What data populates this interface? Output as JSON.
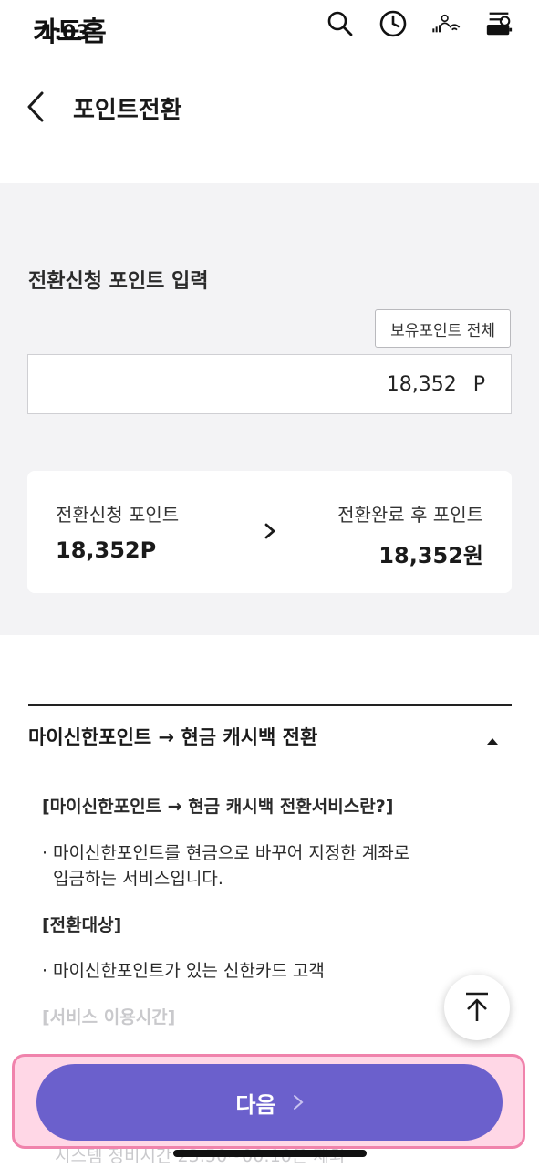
{
  "status_bar": {
    "carrier_title": "카드홈",
    "time": "1:03"
  },
  "header": {
    "title": "포인트전환"
  },
  "form": {
    "section_label": "전환신청 포인트 입력",
    "all_points_button": "보유포인트 전체",
    "amount": "18,352",
    "amount_unit": "P"
  },
  "summary": {
    "left_label": "전환신청 포인트",
    "left_value": "18,352P",
    "right_label": "전환완료 후 포인트",
    "right_value": "18,352원"
  },
  "accordion": {
    "title": "마이신한포인트 → 현금 캐시백 전환"
  },
  "info": {
    "heading1": "[마이신한포인트 → 현금 캐시백 전환서비스란?]",
    "bullet1_line1": "마이신한포인트를 현금으로 바꾸어 지정한 계좌로",
    "bullet1_line2": "입금하는 서비스입니다.",
    "heading2": "[전환대상]",
    "bullet2": "마이신한포인트가 있는 신한카드 고객",
    "heading3": "[서비스 이용시간]",
    "below_text": "시스템 정비시간 23:50~00:10은 제외"
  },
  "footer": {
    "next_button": "다음"
  },
  "colors": {
    "primary": "#6b60cc",
    "panel_bg": "#f3f3f5",
    "highlight_border": "#f083ac"
  }
}
